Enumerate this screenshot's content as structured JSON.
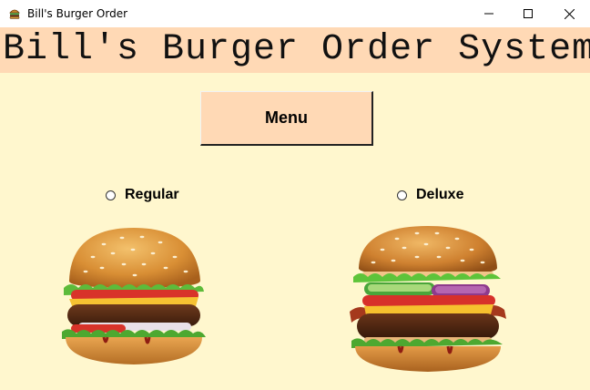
{
  "window": {
    "title": "Bill's Burger Order",
    "icon": "burger-icon",
    "controls": [
      "minimize-icon",
      "maximize-icon",
      "close-icon"
    ]
  },
  "header": {
    "title": "Bill's Burger Order System"
  },
  "menu_button": {
    "label": "Menu"
  },
  "options": [
    {
      "label": "Regular",
      "selected": false,
      "image": "regular-burger-image"
    },
    {
      "label": "Deluxe",
      "selected": false,
      "image": "deluxe-burger-image"
    }
  ],
  "colors": {
    "background": "#fff7ce",
    "header_band": "#ffd9b5",
    "button": "#ffd9b5"
  }
}
